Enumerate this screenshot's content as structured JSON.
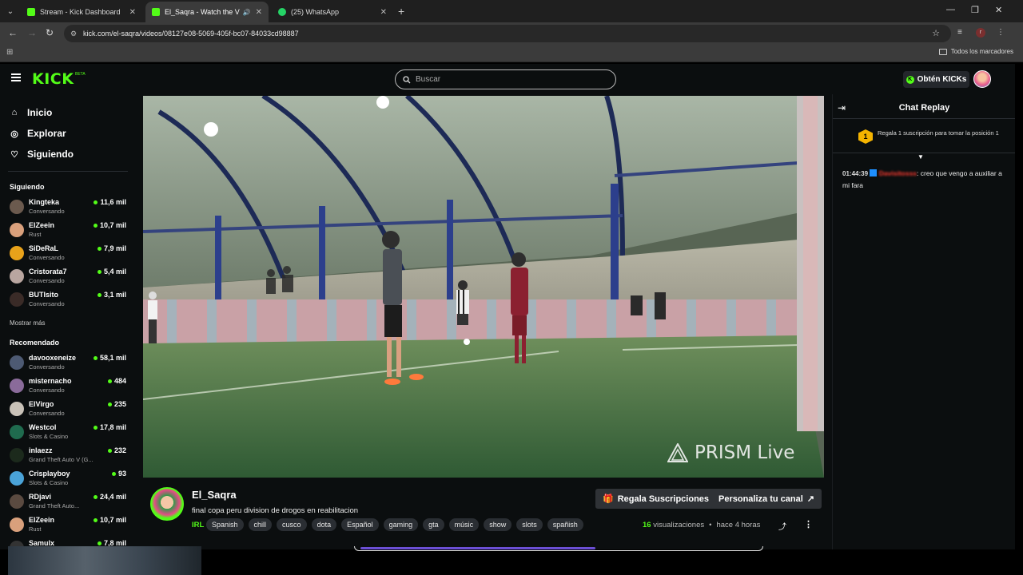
{
  "browser": {
    "tabs": [
      {
        "title": "Stream - Kick Dashboard",
        "icon": "kick-icon"
      },
      {
        "title": "El_Saqra - Watch the VOD c",
        "icon": "kick-icon",
        "active": true
      },
      {
        "title": "(25) WhatsApp",
        "icon": "whatsapp-icon"
      }
    ],
    "url": "kick.com/el-saqra/videos/08127e08-5069-405f-bc07-84033cd98887",
    "bookmarks_all": "Todos los marcadores"
  },
  "kick": {
    "logo": "KICK",
    "logo_badge": "BETA",
    "search_placeholder": "Buscar",
    "kicks_button": "Obtén KICKs"
  },
  "sidebar": {
    "nav": [
      {
        "label": "Inicio",
        "icon": "home-icon"
      },
      {
        "label": "Explorar",
        "icon": "compass-icon"
      },
      {
        "label": "Siguiendo",
        "icon": "heart-icon"
      }
    ],
    "following_heading": "Siguiendo",
    "following": [
      {
        "name": "Kingteka",
        "sub": "Conversando",
        "viewers": "11,6 mil",
        "color": "#6b5a4e"
      },
      {
        "name": "ElZeein",
        "sub": "Rust",
        "viewers": "10,7 mil",
        "color": "#d9a07c"
      },
      {
        "name": "SiDeRaL",
        "sub": "Conversando",
        "viewers": "7,9 mil",
        "color": "#e8a21a"
      },
      {
        "name": "Cristorata7",
        "sub": "Conversando",
        "viewers": "5,4 mil",
        "color": "#b9a6a0"
      },
      {
        "name": "BUTIsito",
        "sub": "Conversando",
        "viewers": "3,1 mil",
        "color": "#3a2b27"
      }
    ],
    "show_more": "Mostrar más",
    "recommended_heading": "Recomendado",
    "recommended": [
      {
        "name": "davooxeneize",
        "sub": "Conversando",
        "viewers": "58,1 mil",
        "color": "#4d5a73"
      },
      {
        "name": "misternacho",
        "sub": "Conversando",
        "viewers": "484",
        "color": "#8a6b9a"
      },
      {
        "name": "ElVirgo",
        "sub": "Conversando",
        "viewers": "235",
        "color": "#c9c2b8"
      },
      {
        "name": "Westcol",
        "sub": "Slots & Casino",
        "viewers": "17,8 mil",
        "color": "#1f6b4e"
      },
      {
        "name": "inlaezz",
        "sub": "Grand Theft Auto V (G...",
        "viewers": "232",
        "color": "#1c2a1c"
      },
      {
        "name": "Crisplayboy",
        "sub": "Slots & Casino",
        "viewers": "93",
        "color": "#4aa3d8"
      },
      {
        "name": "RDjavi",
        "sub": "Grand Theft Auto...",
        "viewers": "24,4 mil",
        "color": "#5a4a40"
      },
      {
        "name": "ElZeein",
        "sub": "Rust",
        "viewers": "10,7 mil",
        "color": "#d9a07c"
      },
      {
        "name": "Samulx",
        "sub": "",
        "viewers": "7,8 mil",
        "color": "#333"
      }
    ]
  },
  "video": {
    "watermark": "PRISM Live"
  },
  "stream": {
    "streamer": "El_Saqra",
    "title": "final copa peru division de drogos en reabilitacion",
    "category": "IRL",
    "tags": [
      "Spanish",
      "chill",
      "cusco",
      "dota",
      "Español",
      "gaming",
      "gta",
      "músic",
      "show",
      "slots",
      "spañish"
    ],
    "gift_button": "Regala Suscripciones",
    "customize_button": "Personaliza tu canal",
    "views_count": "16",
    "views_label": "visualizaciones",
    "separator": "•",
    "time_ago": "hace 4 horas"
  },
  "chat": {
    "title": "Chat Replay",
    "pinned_rank": "1",
    "pinned_text": "Regala 1 suscripción para tomar la posición 1",
    "messages": [
      {
        "time": "01:44:39",
        "user": "Davisitosss",
        "text": ": creo que vengo a auxiliar a mi fara"
      }
    ]
  }
}
